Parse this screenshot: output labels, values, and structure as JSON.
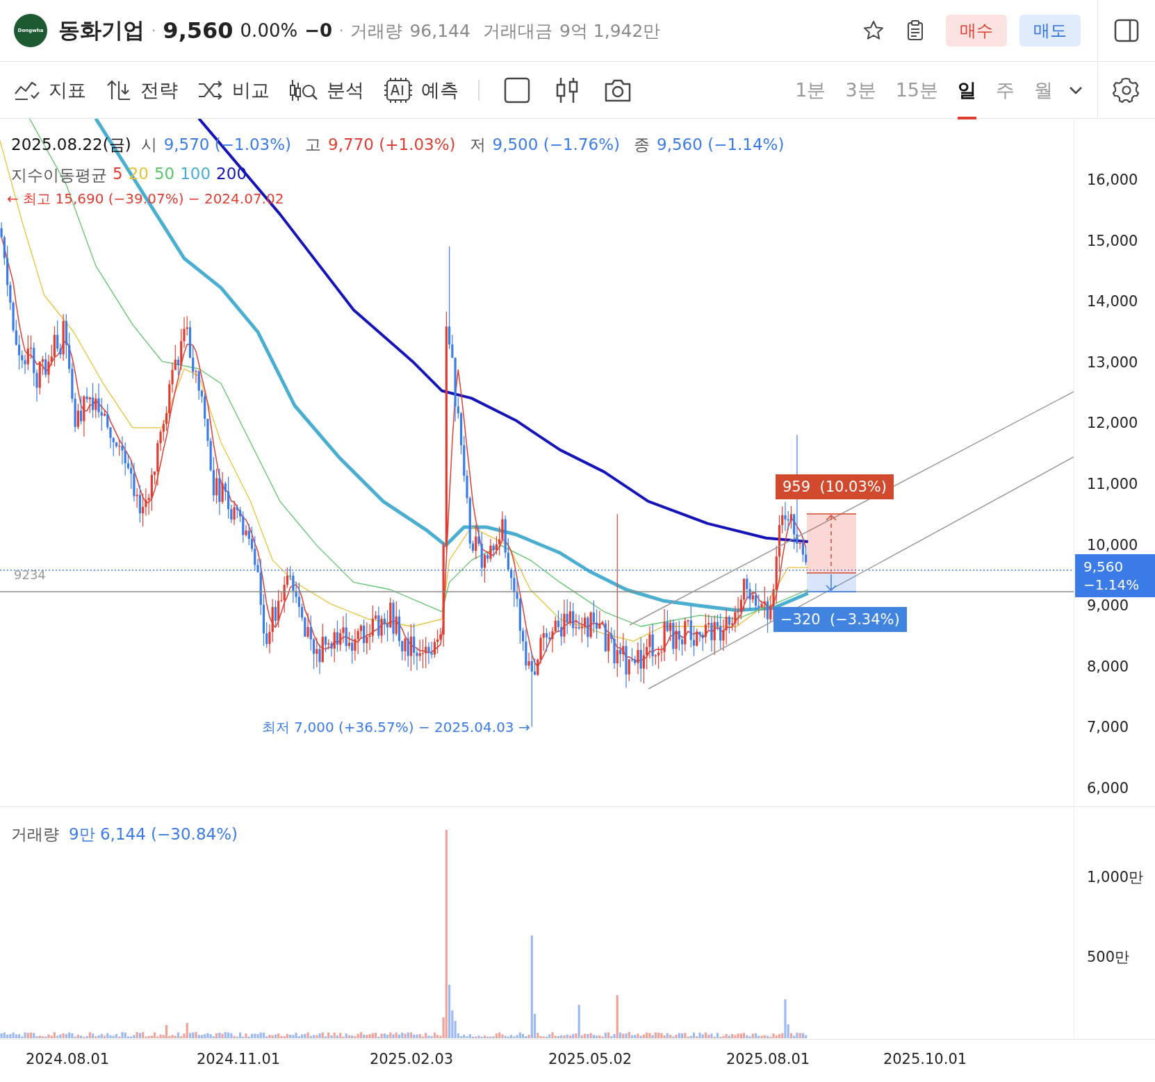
{
  "stock": {
    "logo_text": "Dongwha",
    "name": "동화기업",
    "price": "9,560",
    "change_pct": "0.00%",
    "change": "−0",
    "volume_label": "거래량",
    "volume": "96,144",
    "turnover_label": "거래대금",
    "turnover": "9억 1,942만",
    "separators": [
      "·",
      "·"
    ]
  },
  "header_buttons": [
    {
      "label": "매수",
      "kind": "buy"
    },
    {
      "label": "매도",
      "kind": "sell"
    }
  ],
  "toolbar": [
    {
      "label": "지표",
      "kind": "indicator"
    },
    {
      "label": "전략",
      "kind": "strategy"
    },
    {
      "label": "비교",
      "kind": "compare"
    },
    {
      "label": "분석",
      "kind": "analysis"
    },
    {
      "label": "예측",
      "kind": "ai"
    }
  ],
  "intervals": [
    {
      "label": "1분",
      "selected": false
    },
    {
      "label": "3분",
      "selected": false
    },
    {
      "label": "15분",
      "selected": false
    },
    {
      "label": "일",
      "selected": true
    },
    {
      "label": "주",
      "selected": false
    },
    {
      "label": "월",
      "selected": false
    }
  ],
  "legend": {
    "date": "2025.08.22(금)",
    "ohlc": [
      {
        "label": "시",
        "value": "9,570 (−1.03%)",
        "rising": false
      },
      {
        "label": "고",
        "value": "9,770 (+1.03%)",
        "rising": true
      },
      {
        "label": "저",
        "value": "9,500 (−1.76%)",
        "rising": false
      },
      {
        "label": "종",
        "value": "9,560 (−1.14%)",
        "rising": false
      }
    ],
    "ma_label": "지수이동평균",
    "ma": [
      {
        "period": "5",
        "color": "#e03c31"
      },
      {
        "period": "20",
        "color": "#e8c13a"
      },
      {
        "period": "50",
        "color": "#5cc46a"
      },
      {
        "period": "100",
        "color": "#4aaed0"
      },
      {
        "period": "200",
        "color": "#1414b8"
      }
    ]
  },
  "annotations": {
    "high": "← 최고 15,690 (−39.07%) − 2024.07.02",
    "low": "최저 7,000 (+36.57%) − 2025.04.03 →",
    "line_value": "9234",
    "rise": "959  (10.03%)",
    "fall": "−320  (−3.34%)"
  },
  "price_tag": {
    "price": "9,560",
    "change": "−1.14%"
  },
  "price_ticks": [
    "16,000",
    "15,000",
    "14,000",
    "13,000",
    "12,000",
    "11,000",
    "10,000",
    "9,000",
    "8,000",
    "7,000",
    "6,000"
  ],
  "volume_pane": {
    "label": "거래량",
    "value": "9만 6,144 (−30.84%)",
    "ticks": [
      "1,000만",
      "500만"
    ]
  },
  "dates": [
    "2024.08.01",
    "2024.11.01",
    "2025.02.03",
    "2025.05.02",
    "2025.08.01",
    "2025.10.01"
  ]
}
